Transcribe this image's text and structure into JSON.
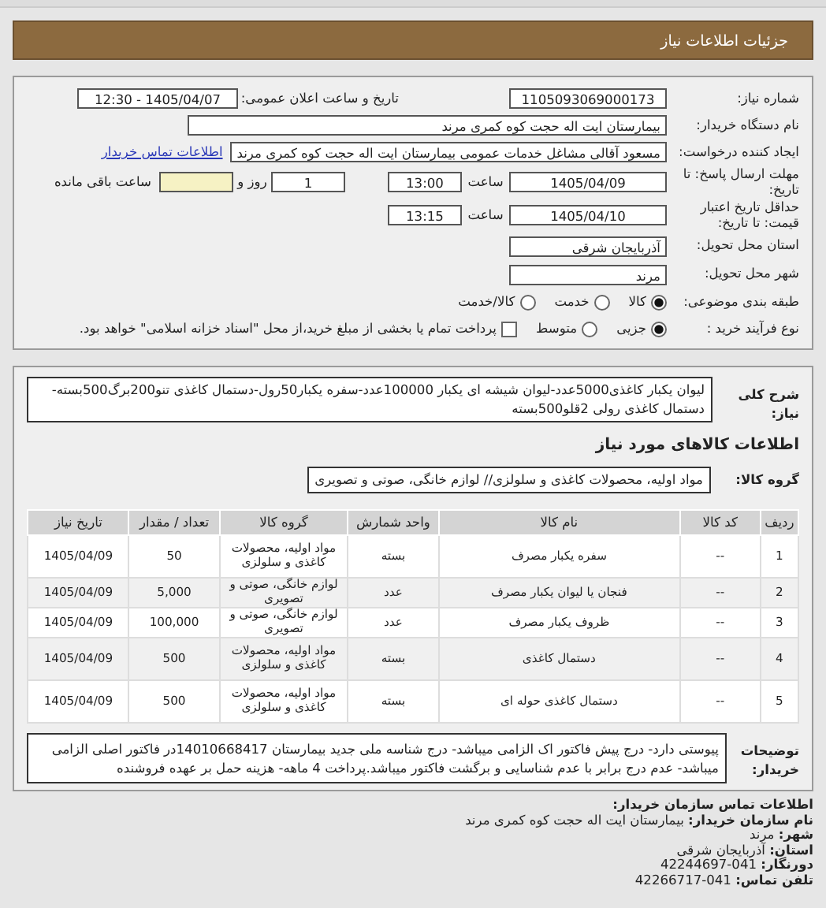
{
  "header": {
    "title": "جزئیات اطلاعات نیاز"
  },
  "form": {
    "need_number": {
      "label": "شماره نیاز:",
      "value": "1105093069000173"
    },
    "announce": {
      "label": "تاریخ و ساعت اعلان عمومی:",
      "value": "12:30 - 1405/04/07"
    },
    "buyer_org": {
      "label": "نام دستگاه خریدار:",
      "value": "بیمارستان ایت اله حجت کوه کمری مرند"
    },
    "requester": {
      "label": "ایجاد کننده درخواست:",
      "value": "مسعود آقالی مشاغل خدمات عمومی بیمارستان ایت اله حجت کوه کمری مرند",
      "link": "اطلاعات تماس خریدار"
    },
    "deadline": {
      "label": "مهلت ارسال پاسخ: تا تاریخ:",
      "date": "1405/04/09",
      "time_label": "ساعت",
      "time": "13:00",
      "days": "1",
      "days_label": "روز و",
      "remaining_label": "ساعت باقی مانده"
    },
    "validity": {
      "label": "حداقل تاریخ اعتبار قیمت: تا تاریخ:",
      "date": "1405/04/10",
      "time_label": "ساعت",
      "time": "13:15"
    },
    "province": {
      "label": "استان محل تحویل:",
      "value": "آذربایجان شرقی"
    },
    "city": {
      "label": "شهر محل تحویل:",
      "value": "مرند"
    },
    "category": {
      "label": "طبقه بندی موضوعی:",
      "options": [
        {
          "kind": "radio",
          "label": "کالا",
          "selected": true
        },
        {
          "kind": "radio",
          "label": "خدمت",
          "selected": false
        },
        {
          "kind": "radio",
          "label": "کالا/خدمت",
          "selected": false
        }
      ]
    },
    "purchase_type": {
      "label": "نوع فرآیند خرید :",
      "options": [
        {
          "kind": "radio",
          "label": "جزیی",
          "selected": true
        },
        {
          "kind": "radio",
          "label": "متوسط",
          "selected": false
        },
        {
          "kind": "checkbox",
          "label": "پرداخت تمام یا بخشی از مبلغ خرید،از محل \"اسناد خزانه اسلامی\" خواهد بود.",
          "checked": false
        }
      ]
    }
  },
  "description": {
    "label": "شرح کلی نیاز:",
    "text": "لیوان یکبار کاغذی5000عدد-لیوان شیشه ای یکبار 100000عدد-سفره یکبار50رول-دستمال کاغذی تنو200برگ500بسته-دستمال کاغذی رولی 2قلو500بسته"
  },
  "goods_title": "اطلاعات کالاهای مورد نیاز",
  "goods_group": {
    "label": "گروه کالا:",
    "value": "مواد اولیه، محصولات کاغذی و سلولزی// لوازم خانگی، صوتی و تصویری"
  },
  "table": {
    "columns": [
      "ردیف",
      "کد کالا",
      "نام کالا",
      "واحد شمارش",
      "گروه کالا",
      "تعداد / مقدار",
      "تاریخ نیاز"
    ],
    "rows": [
      [
        "1",
        "--",
        "سفره یکبار مصرف",
        "بسته",
        "مواد اولیه، محصولات کاغذی و سلولزی",
        "50",
        "1405/04/09"
      ],
      [
        "2",
        "--",
        "فنجان یا لیوان یکبار مصرف",
        "عدد",
        "لوازم خانگی، صوتی و تصویری",
        "5,000",
        "1405/04/09"
      ],
      [
        "3",
        "--",
        "ظروف یکبار مصرف",
        "عدد",
        "لوازم خانگی، صوتی و تصویری",
        "100,000",
        "1405/04/09"
      ],
      [
        "4",
        "--",
        "دستمال کاغذی",
        "بسته",
        "مواد اولیه، محصولات کاغذی و سلولزی",
        "500",
        "1405/04/09"
      ],
      [
        "5",
        "--",
        "دستمال کاغذی حوله ای",
        "بسته",
        "مواد اولیه، محصولات کاغذی و سلولزی",
        "500",
        "1405/04/09"
      ]
    ]
  },
  "buyer_notes": {
    "label": "توضیحات خریدار:",
    "text": "پیوستی دارد- درج پیش فاکتور اک الزامی میباشد- درج شناسه ملی جدید بیمارستان 14010668417در فاکتور اصلی الزامی میباشد- عدم درج برابر با عدم شناسایی و برگشت فاکتور میباشد.پرداخت 4 ماهه- هزینه حمل بر عهده فروشنده"
  },
  "contact": {
    "title": "اطلاعات تماس سازمان خریدار:",
    "items": [
      {
        "label": "نام سازمان خریدار:",
        "value": "بیمارستان ایت اله حجت کوه کمری مرند"
      },
      {
        "label": "شهر:",
        "value": "مرند"
      },
      {
        "label": "استان:",
        "value": "آذربایجان شرقی"
      },
      {
        "label": "دورنگار:",
        "value": "42244697-041"
      },
      {
        "label": "تلفن تماس:",
        "value": "42266717-041"
      }
    ]
  }
}
